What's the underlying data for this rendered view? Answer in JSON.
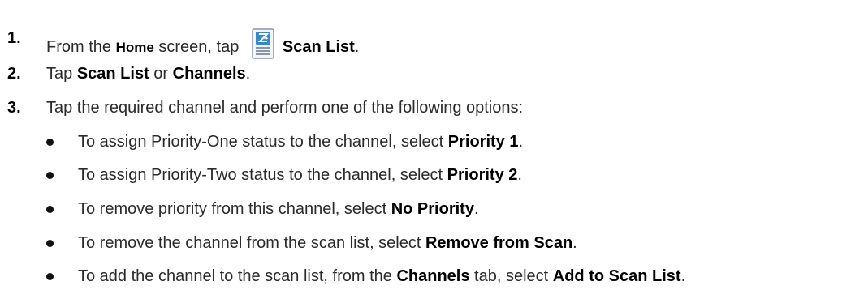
{
  "steps": [
    {
      "number": "1.",
      "parts": {
        "a": "From the ",
        "b": "Home",
        "c": " screen, tap ",
        "d": "Scan List",
        "e": "."
      },
      "icon": "scan-list-app-icon"
    },
    {
      "number": "2.",
      "parts": {
        "a": "Tap ",
        "b": "Scan List",
        "c": " or ",
        "d": "Channels",
        "e": "."
      }
    },
    {
      "number": "3.",
      "text": "Tap the required channel and perform one of the following options:"
    }
  ],
  "options": [
    {
      "lead": "To assign Priority-One status to the channel, select ",
      "bold": "Priority 1",
      "tail": "."
    },
    {
      "lead": "To assign Priority-Two status to the channel, select ",
      "bold": "Priority 2",
      "tail": "."
    },
    {
      "lead": "To remove priority from this channel, select ",
      "bold": "No Priority",
      "tail": "."
    },
    {
      "lead": "To remove the channel from the scan list, select ",
      "bold": "Remove from Scan",
      "tail": "."
    },
    {
      "lead": "To add the channel to the scan list, from the ",
      "bold": "Channels",
      "mid": " tab, select ",
      "bold2": "Add to Scan List",
      "tail": "."
    }
  ],
  "colors": {
    "text": "#2b2b2b",
    "emphasis": "#000000",
    "icon_blue": "#3a86c8"
  }
}
